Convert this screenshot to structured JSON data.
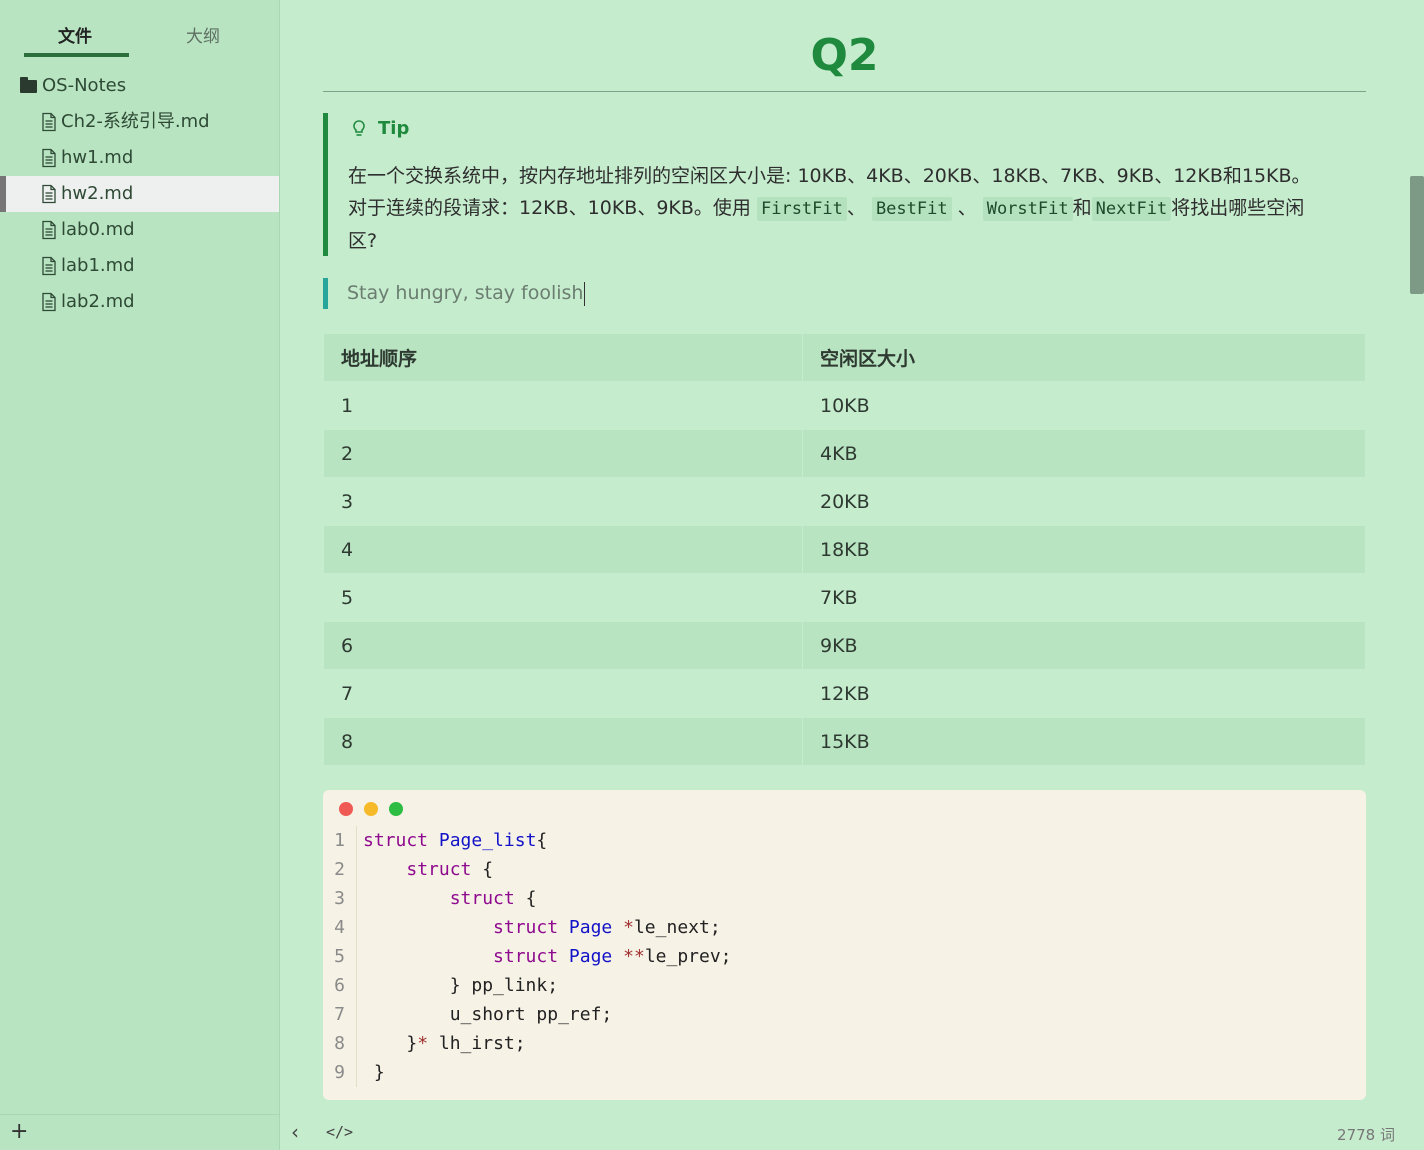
{
  "sidebar": {
    "tabs": {
      "files": "文件",
      "outline": "大纲"
    },
    "folder": "OS-Notes",
    "files": [
      "Ch2-系统引导.md",
      "hw1.md",
      "hw2.md",
      "lab0.md",
      "lab1.md",
      "lab2.md"
    ],
    "active_file": "hw2.md",
    "add_label": "+"
  },
  "document": {
    "title": "Q2",
    "tip": {
      "label": "Tip",
      "line1": "在一个交换系统中，按内存地址排列的空闲区大小是: 10KB、4KB、20KB、18KB、7KB、9KB、12KB和15KB。",
      "line2_prefix": "对于连续的段请求：12KB、10KB、9KB。使用",
      "code1": "FirstFit",
      "sep1": "、",
      "code2": "BestFit",
      "sep2": "、",
      "code3": "WorstFit",
      "conj": "和",
      "code4": "NextFit",
      "line2_suffix": "将找出哪些空闲",
      "line3": "区?"
    },
    "quote": "Stay hungry, stay foolish",
    "table": {
      "headers": [
        "地址顺序",
        "空闲区大小"
      ],
      "rows": [
        [
          "1",
          "10KB"
        ],
        [
          "2",
          "4KB"
        ],
        [
          "3",
          "20KB"
        ],
        [
          "4",
          "18KB"
        ],
        [
          "5",
          "7KB"
        ],
        [
          "6",
          "9KB"
        ],
        [
          "7",
          "12KB"
        ],
        [
          "8",
          "15KB"
        ]
      ]
    },
    "code": {
      "lines": [
        {
          "n": "1",
          "indent": "",
          "tokens": [
            [
              "kw",
              "struct"
            ],
            [
              "pl",
              " "
            ],
            [
              "ty",
              "Page_list"
            ],
            [
              "pl",
              "{"
            ]
          ]
        },
        {
          "n": "2",
          "indent": "    ",
          "tokens": [
            [
              "kw",
              "struct"
            ],
            [
              "pl",
              " {"
            ]
          ]
        },
        {
          "n": "3",
          "indent": "        ",
          "tokens": [
            [
              "kw",
              "struct"
            ],
            [
              "pl",
              " {"
            ]
          ]
        },
        {
          "n": "4",
          "indent": "            ",
          "tokens": [
            [
              "kw",
              "struct"
            ],
            [
              "pl",
              " "
            ],
            [
              "ty",
              "Page"
            ],
            [
              "pl",
              " "
            ],
            [
              "op",
              "*"
            ],
            [
              "pl",
              "le_next;"
            ]
          ]
        },
        {
          "n": "5",
          "indent": "            ",
          "tokens": [
            [
              "kw",
              "struct"
            ],
            [
              "pl",
              " "
            ],
            [
              "ty",
              "Page"
            ],
            [
              "pl",
              " "
            ],
            [
              "op",
              "**"
            ],
            [
              "pl",
              "le_prev;"
            ]
          ]
        },
        {
          "n": "6",
          "indent": "        ",
          "tokens": [
            [
              "pl",
              "} pp_link;"
            ]
          ]
        },
        {
          "n": "7",
          "indent": "        ",
          "tokens": [
            [
              "pl",
              "u_short pp_ref;"
            ]
          ]
        },
        {
          "n": "8",
          "indent": "    ",
          "tokens": [
            [
              "pl",
              "}"
            ],
            [
              "op",
              "*"
            ],
            [
              "pl",
              " lh_irst;"
            ]
          ]
        },
        {
          "n": "9",
          "indent": " ",
          "tokens": [
            [
              "pl",
              "}"
            ]
          ]
        }
      ]
    }
  },
  "statusbar": {
    "back": "‹",
    "source": "</>",
    "word_count": "2778 词"
  },
  "colors": {
    "accent": "#1f8a3e",
    "quote_bar": "#27a59a",
    "background": "#c6ecce"
  }
}
